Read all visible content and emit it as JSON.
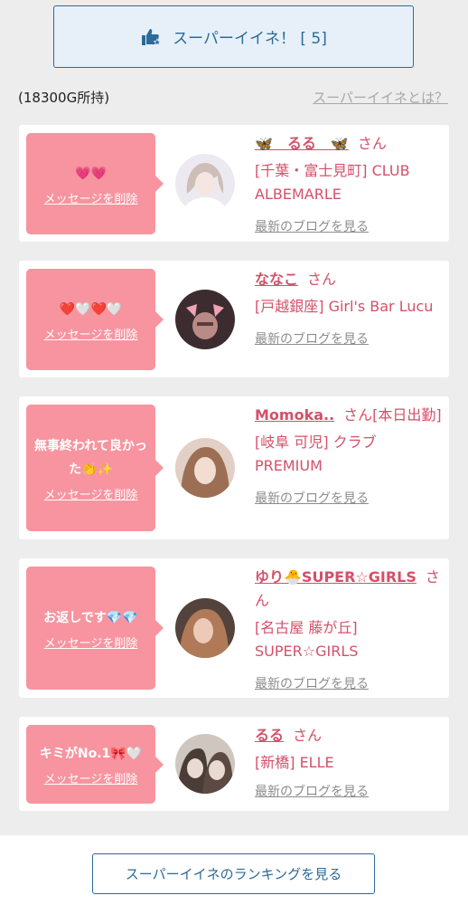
{
  "header": {
    "super_like_label": "スーパーイイネ！ [ 5]",
    "balance": "(18300G所持)",
    "about_link": "スーパーイイネとは？"
  },
  "messages": [
    {
      "message": "💗💗",
      "delete_label": "メッセージを削除",
      "name": "🦋　るる　🦋",
      "suffix": "さん",
      "shop": "[千葉・富士見町] CLUB ALBEMARLE",
      "blog_link": "最新のブログを見る"
    },
    {
      "message": "❤️🤍❤️🤍",
      "delete_label": "メッセージを削除",
      "name": "ななこ",
      "suffix": "さん",
      "shop": "[戸越銀座] Girl's Bar Lucu",
      "blog_link": "最新のブログを見る"
    },
    {
      "message": "無事終われて良かった👏✨",
      "delete_label": "メッセージを削除",
      "name": "Momoka..",
      "suffix": "さん[本日出勤]",
      "shop": "[岐阜 可児] クラブ PREMIUM",
      "blog_link": "最新のブログを見る"
    },
    {
      "message": "お返しです💎💎",
      "delete_label": "メッセージを削除",
      "name": "ゆり🐣SUPER☆GIRLS",
      "suffix": "さん",
      "shop": "[名古屋 藤が丘] SUPER☆GIRLS",
      "blog_link": "最新のブログを見る"
    },
    {
      "message": "キミがNo.1🎀🤍",
      "delete_label": "メッセージを削除",
      "name": "るる",
      "suffix": "さん",
      "shop": "[新橋] ELLE",
      "blog_link": "最新のブログを見る"
    }
  ],
  "footer": {
    "ranking_button": "スーパーイイネのランキングを見る"
  },
  "colors": {
    "accent_blue": "#2c6a99",
    "bubble_pink": "#f7949f",
    "name_pink": "#d4506a",
    "page_bg": "#ededed"
  },
  "icons": {
    "super_like": "thumbs-up-star-icon"
  }
}
